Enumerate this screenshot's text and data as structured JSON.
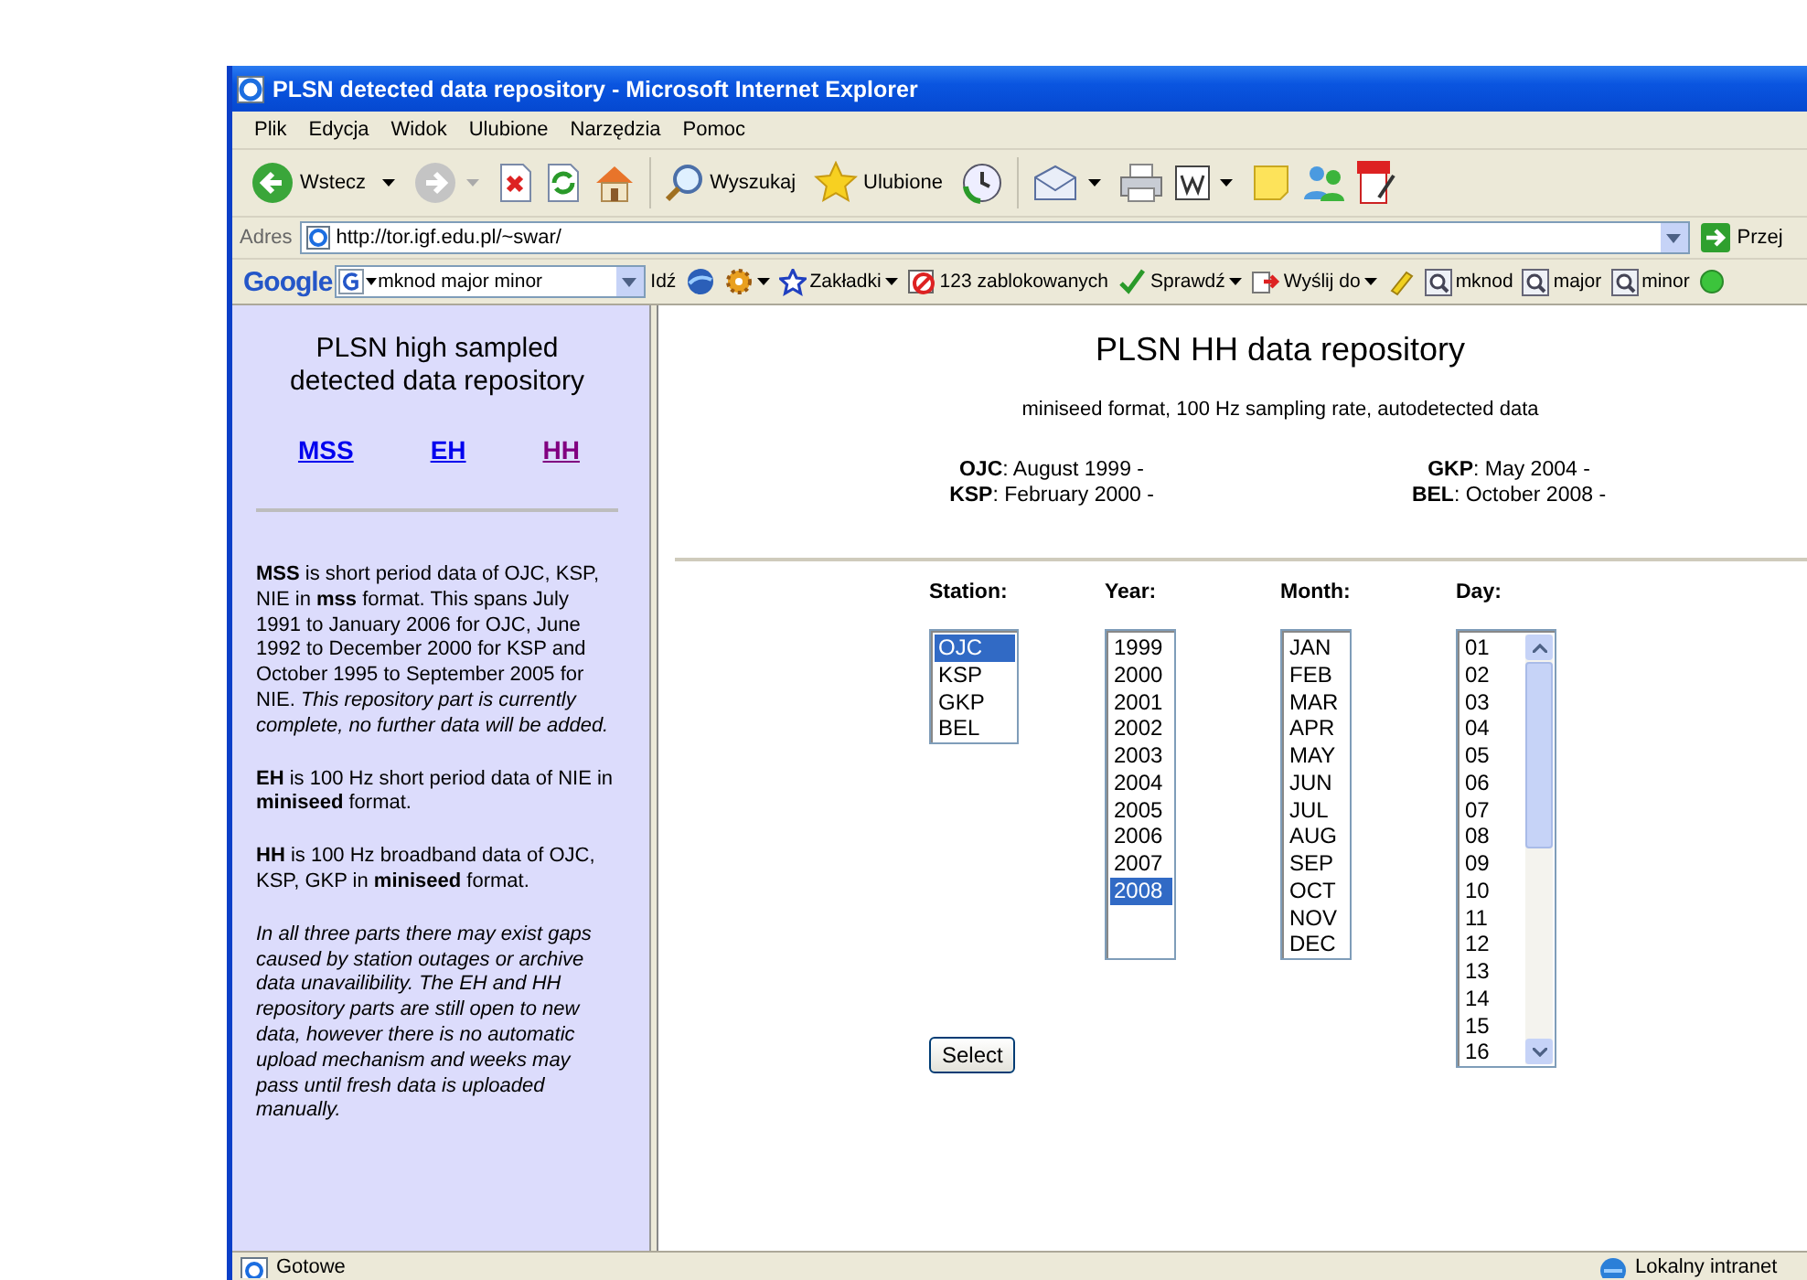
{
  "window": {
    "title": "PLSN detected data repository - Microsoft Internet Explorer"
  },
  "menu": [
    "Plik",
    "Edycja",
    "Widok",
    "Ulubione",
    "Narzędzia",
    "Pomoc"
  ],
  "toolbar": [
    [
      {
        "kind": "back",
        "label": "Wstecz",
        "dropdown": true
      },
      {
        "kind": "forward",
        "dropdown": true
      },
      {
        "kind": "stop"
      },
      {
        "kind": "refresh"
      },
      {
        "kind": "home"
      }
    ],
    [
      {
        "kind": "search",
        "label": "Wyszukaj"
      },
      {
        "kind": "favorites",
        "label": "Ulubione"
      },
      {
        "kind": "history"
      }
    ],
    [
      {
        "kind": "mail",
        "dropdown": true
      },
      {
        "kind": "print"
      },
      {
        "kind": "word",
        "dropdown": true
      },
      {
        "kind": "note"
      },
      {
        "kind": "people"
      },
      {
        "kind": "pdf"
      }
    ]
  ],
  "address": {
    "label": "Adres",
    "url": "http://tor.igf.edu.pl/~swar/",
    "go": "Przej"
  },
  "google_bar": {
    "logo": "Google",
    "query": "mknod major minor",
    "go": "Idź",
    "items": [
      {
        "kind": "globe"
      },
      {
        "kind": "gear",
        "dropdown": true
      },
      {
        "kind": "star",
        "label": "Zakładki",
        "dropdown": true
      },
      {
        "kind": "block",
        "label": "123 zablokowanych"
      },
      {
        "kind": "spell",
        "label": "Sprawdź",
        "dropdown": true
      },
      {
        "kind": "send",
        "label": "Wyślij do",
        "dropdown": true
      },
      {
        "kind": "pen"
      },
      {
        "kind": "find",
        "label": "mknod"
      },
      {
        "kind": "find",
        "label": "major"
      },
      {
        "kind": "find",
        "label": "minor"
      },
      {
        "kind": "dot"
      }
    ]
  },
  "sidebar": {
    "title": "PLSN high sampled detected data repository",
    "links": [
      {
        "label": "MSS",
        "visited": false
      },
      {
        "label": "EH",
        "visited": false
      },
      {
        "label": "HH",
        "visited": true
      }
    ],
    "paragraphs": [
      {
        "kind": "plain",
        "text": "**MSS** is short period data of OJC, KSP, NIE in **mss** format. This spans July 1991 to January 2006 for OJC, June 1992 to December 2000 for KSP and October 1995 to September 2005 for NIE. *This repository part is currently complete, no further data will be added.*"
      },
      {
        "kind": "plain",
        "text": "**EH** is 100 Hz short period data of NIE in **miniseed** format."
      },
      {
        "kind": "plain",
        "text": "**HH** is 100 Hz broadband data of OJC, KSP, GKP in **miniseed** format."
      },
      {
        "kind": "note",
        "text": "In all three parts there may exist gaps caused by station outages or archive data unavailibility. The EH and HH repository parts are still open to new data, however there is no automatic upload mechanism and weeks may pass until fresh data is uploaded manually."
      }
    ]
  },
  "main": {
    "title": "PLSN HH data repository",
    "subtitle": "miniseed format, 100 Hz sampling rate, autodetected data",
    "stations": [
      [
        "**OJC**: August 1999 -",
        "**KSP**: February 2000 -"
      ],
      [
        "**GKP**: May 2004 -",
        "**BEL**: October 2008 -"
      ]
    ],
    "form": {
      "fields": [
        {
          "label": "Station:",
          "scroll": false,
          "options": [
            {
              "text": "OJC",
              "selected": true
            },
            {
              "text": "KSP",
              "selected": false
            },
            {
              "text": "GKP",
              "selected": false
            },
            {
              "text": "BEL",
              "selected": false
            }
          ]
        },
        {
          "label": "Year:",
          "scroll": false,
          "options": [
            {
              "text": "1999",
              "selected": false
            },
            {
              "text": "2000",
              "selected": false
            },
            {
              "text": "2001",
              "selected": false
            },
            {
              "text": "2002",
              "selected": false
            },
            {
              "text": "2003",
              "selected": false
            },
            {
              "text": "2004",
              "selected": false
            },
            {
              "text": "2005",
              "selected": false
            },
            {
              "text": "2006",
              "selected": false
            },
            {
              "text": "2007",
              "selected": false
            },
            {
              "text": "2008",
              "selected": true
            }
          ]
        },
        {
          "label": "Month:",
          "scroll": false,
          "options": [
            {
              "text": "JAN",
              "selected": false
            },
            {
              "text": "FEB",
              "selected": false
            },
            {
              "text": "MAR",
              "selected": false
            },
            {
              "text": "APR",
              "selected": false
            },
            {
              "text": "MAY",
              "selected": false
            },
            {
              "text": "JUN",
              "selected": false
            },
            {
              "text": "JUL",
              "selected": false
            },
            {
              "text": "AUG",
              "selected": false
            },
            {
              "text": "SEP",
              "selected": false
            },
            {
              "text": "OCT",
              "selected": false
            },
            {
              "text": "NOV",
              "selected": false
            },
            {
              "text": "DEC",
              "selected": false
            }
          ]
        },
        {
          "label": "Day:",
          "scroll": true,
          "options": [
            {
              "text": "01",
              "selected": false
            },
            {
              "text": "02",
              "selected": false
            },
            {
              "text": "03",
              "selected": false
            },
            {
              "text": "04",
              "selected": false
            },
            {
              "text": "05",
              "selected": false
            },
            {
              "text": "06",
              "selected": false
            },
            {
              "text": "07",
              "selected": false
            },
            {
              "text": "08",
              "selected": false
            },
            {
              "text": "09",
              "selected": false
            },
            {
              "text": "10",
              "selected": false
            },
            {
              "text": "11",
              "selected": false
            },
            {
              "text": "12",
              "selected": false
            },
            {
              "text": "13",
              "selected": false
            },
            {
              "text": "14",
              "selected": false
            },
            {
              "text": "15",
              "selected": false
            },
            {
              "text": "16",
              "selected": false
            }
          ]
        }
      ],
      "button": "Select"
    }
  },
  "status_bar": {
    "text": "Gotowe",
    "zone": "Lokalny intranet"
  }
}
